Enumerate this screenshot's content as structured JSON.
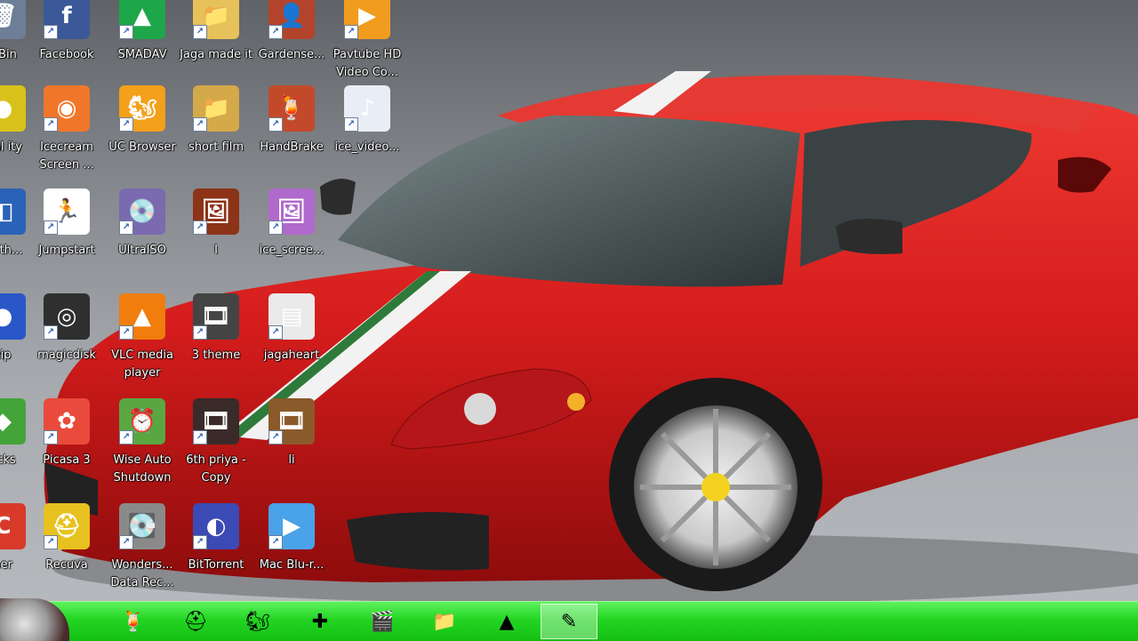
{
  "desktop": {
    "icons": [
      {
        "label": "s Bin",
        "glyph": "🗑",
        "color": "#6d7e96",
        "icon": "recycle-bin-icon"
      },
      {
        "label": "Facebook",
        "glyph": "f",
        "color": "#3b5998",
        "icon": "facebook-icon"
      },
      {
        "label": "SMADAV",
        "glyph": "▲",
        "color": "#1da64a",
        "icon": "smadav-icon"
      },
      {
        "label": "Jaga made it",
        "glyph": "📁",
        "color": "#e7c15a",
        "icon": "folder-icon"
      },
      {
        "label": "Gardense...",
        "glyph": "👤",
        "color": "#b3442b",
        "icon": "gardenscapes-icon"
      },
      {
        "label": "Pavtube HD Video Co...",
        "glyph": "▶",
        "color": "#f29c1f",
        "icon": "pavtube-icon"
      },
      {
        "label": "pial ity",
        "glyph": "●",
        "color": "#d8c21a",
        "icon": "app-icon"
      },
      {
        "label": "Icecream Screen ...",
        "glyph": "◉",
        "color": "#f0772a",
        "icon": "icecream-screen-recorder-icon"
      },
      {
        "label": "UC Browser",
        "glyph": "🐿",
        "color": "#f3a01b",
        "icon": "uc-browser-icon"
      },
      {
        "label": "short film",
        "glyph": "📁",
        "color": "#d3a94a",
        "icon": "folder-icon"
      },
      {
        "label": "HandBrake",
        "glyph": "🍹",
        "color": "#c24a2a",
        "icon": "handbrake-icon"
      },
      {
        "label": "ice_video...",
        "glyph": "♪",
        "color": "#e9eef6",
        "icon": "m4a-file-icon"
      },
      {
        "label": "se th...",
        "glyph": "◧",
        "color": "#2a62b8",
        "icon": "app-icon"
      },
      {
        "label": "Jumpstart",
        "glyph": "🏃",
        "color": "#ffffff",
        "icon": "jumpstart-icon"
      },
      {
        "label": "UltraISO",
        "glyph": "💿",
        "color": "#7b6ab0",
        "icon": "ultraiso-icon"
      },
      {
        "label": "I",
        "glyph": "🖼",
        "color": "#8d3318",
        "icon": "image-file-icon"
      },
      {
        "label": "ice_scree...",
        "glyph": "🖼",
        "color": "#b06acb",
        "icon": "image-file-icon"
      },
      {
        "label": "zip",
        "glyph": "●",
        "color": "#2a57c8",
        "icon": "zip-icon"
      },
      {
        "label": "magicdisk",
        "glyph": "◎",
        "color": "#2f2f2f",
        "icon": "magicdisk-icon"
      },
      {
        "label": "VLC media player",
        "glyph": "▲",
        "color": "#f07d0c",
        "icon": "vlc-icon"
      },
      {
        "label": "3 theme",
        "glyph": "🎞",
        "color": "#444444",
        "icon": "video-file-icon"
      },
      {
        "label": "jagaheart",
        "glyph": "▤",
        "color": "#eaeaea",
        "icon": "document-icon"
      },
      {
        "label": "acks",
        "glyph": "◆",
        "color": "#43a43a",
        "icon": "app-icon"
      },
      {
        "label": "Picasa 3",
        "glyph": "✿",
        "color": "#e94a3c",
        "icon": "picasa-icon"
      },
      {
        "label": "Wise Auto Shutdown",
        "glyph": "⏰",
        "color": "#5aa742",
        "icon": "wise-auto-shutdown-icon"
      },
      {
        "label": "6th priya - Copy",
        "glyph": "🎞",
        "color": "#3a2a2a",
        "icon": "video-file-icon"
      },
      {
        "label": "li",
        "glyph": "🎞",
        "color": "#8a5a2a",
        "icon": "video-file-icon"
      },
      {
        "label": "ner",
        "glyph": "C",
        "color": "#d83a2a",
        "icon": "app-icon"
      },
      {
        "label": "Recuva",
        "glyph": "⛑",
        "color": "#e7c11f",
        "icon": "recuva-icon"
      },
      {
        "label": "Wonders... Data Rec...",
        "glyph": "💽",
        "color": "#8a8a8a",
        "icon": "wondershare-icon"
      },
      {
        "label": "BitTorrent",
        "glyph": "◐",
        "color": "#3b4ab5",
        "icon": "bittorrent-icon"
      },
      {
        "label": "Mac Blu-r...",
        "glyph": "▶",
        "color": "#4aa2e8",
        "icon": "mac-bluray-icon"
      }
    ]
  },
  "taskbar": {
    "items": [
      {
        "glyph": "🍹",
        "name": "handbrake-taskbar-icon"
      },
      {
        "glyph": "⛑",
        "name": "recuva-taskbar-icon"
      },
      {
        "glyph": "🐿",
        "name": "uc-browser-taskbar-icon"
      },
      {
        "glyph": "✚",
        "name": "add-app-taskbar-icon"
      },
      {
        "glyph": "🎬",
        "name": "video-editor-taskbar-icon"
      },
      {
        "glyph": "📁",
        "name": "file-explorer-taskbar-icon"
      },
      {
        "glyph": "▲",
        "name": "vlc-taskbar-icon"
      },
      {
        "glyph": "✎",
        "name": "paint-taskbar-icon"
      }
    ]
  },
  "colors": {
    "taskbar": "#23d523",
    "car": "#d91f1f",
    "label_text": "#ffffff"
  }
}
